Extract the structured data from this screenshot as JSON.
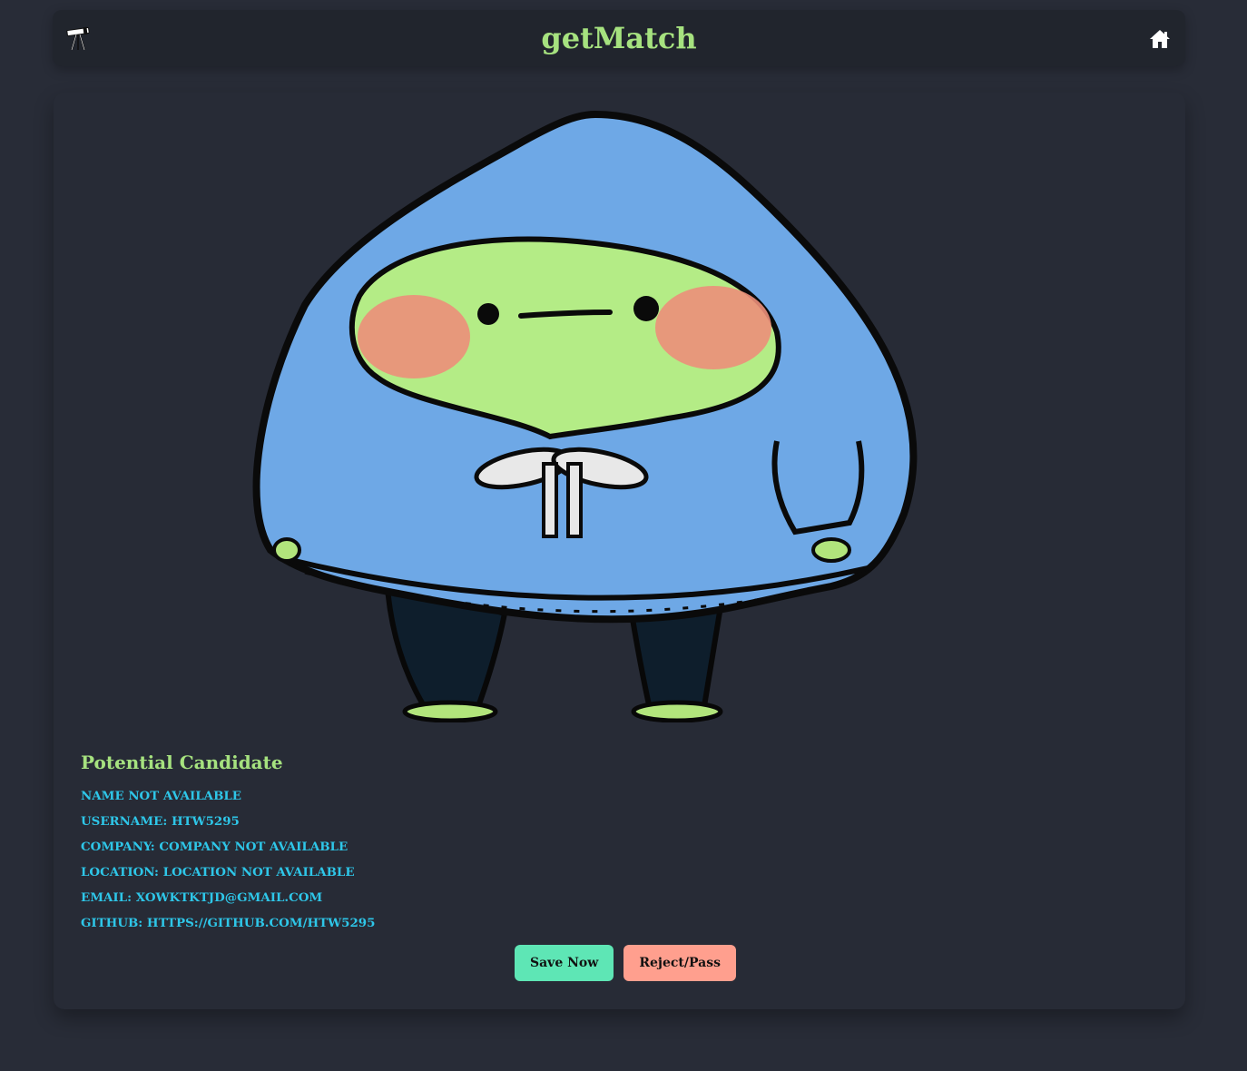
{
  "app": {
    "title": "getMatch"
  },
  "header": {
    "logo_icon": "telescope-icon",
    "home_icon": "home-icon"
  },
  "candidate": {
    "heading": "Potential Candidate",
    "name": "Name not available",
    "username": "Username: htw5295",
    "company": "Company: Company not available",
    "location": "Location: Location not available",
    "email": "Email: xowktktjd@gmail.com",
    "github": "Github: https://github.com/htw5295",
    "avatar_icon": "hooded-character-illustration"
  },
  "actions": {
    "save_label": "Save Now",
    "reject_label": "Reject/Pass"
  },
  "colors": {
    "background": "#282c37",
    "navbar": "#21252d",
    "accent_green": "#a6e27f",
    "field_text": "#2ec6e8",
    "save_button": "#5ee6b5",
    "reject_button": "#ff9f8e"
  }
}
